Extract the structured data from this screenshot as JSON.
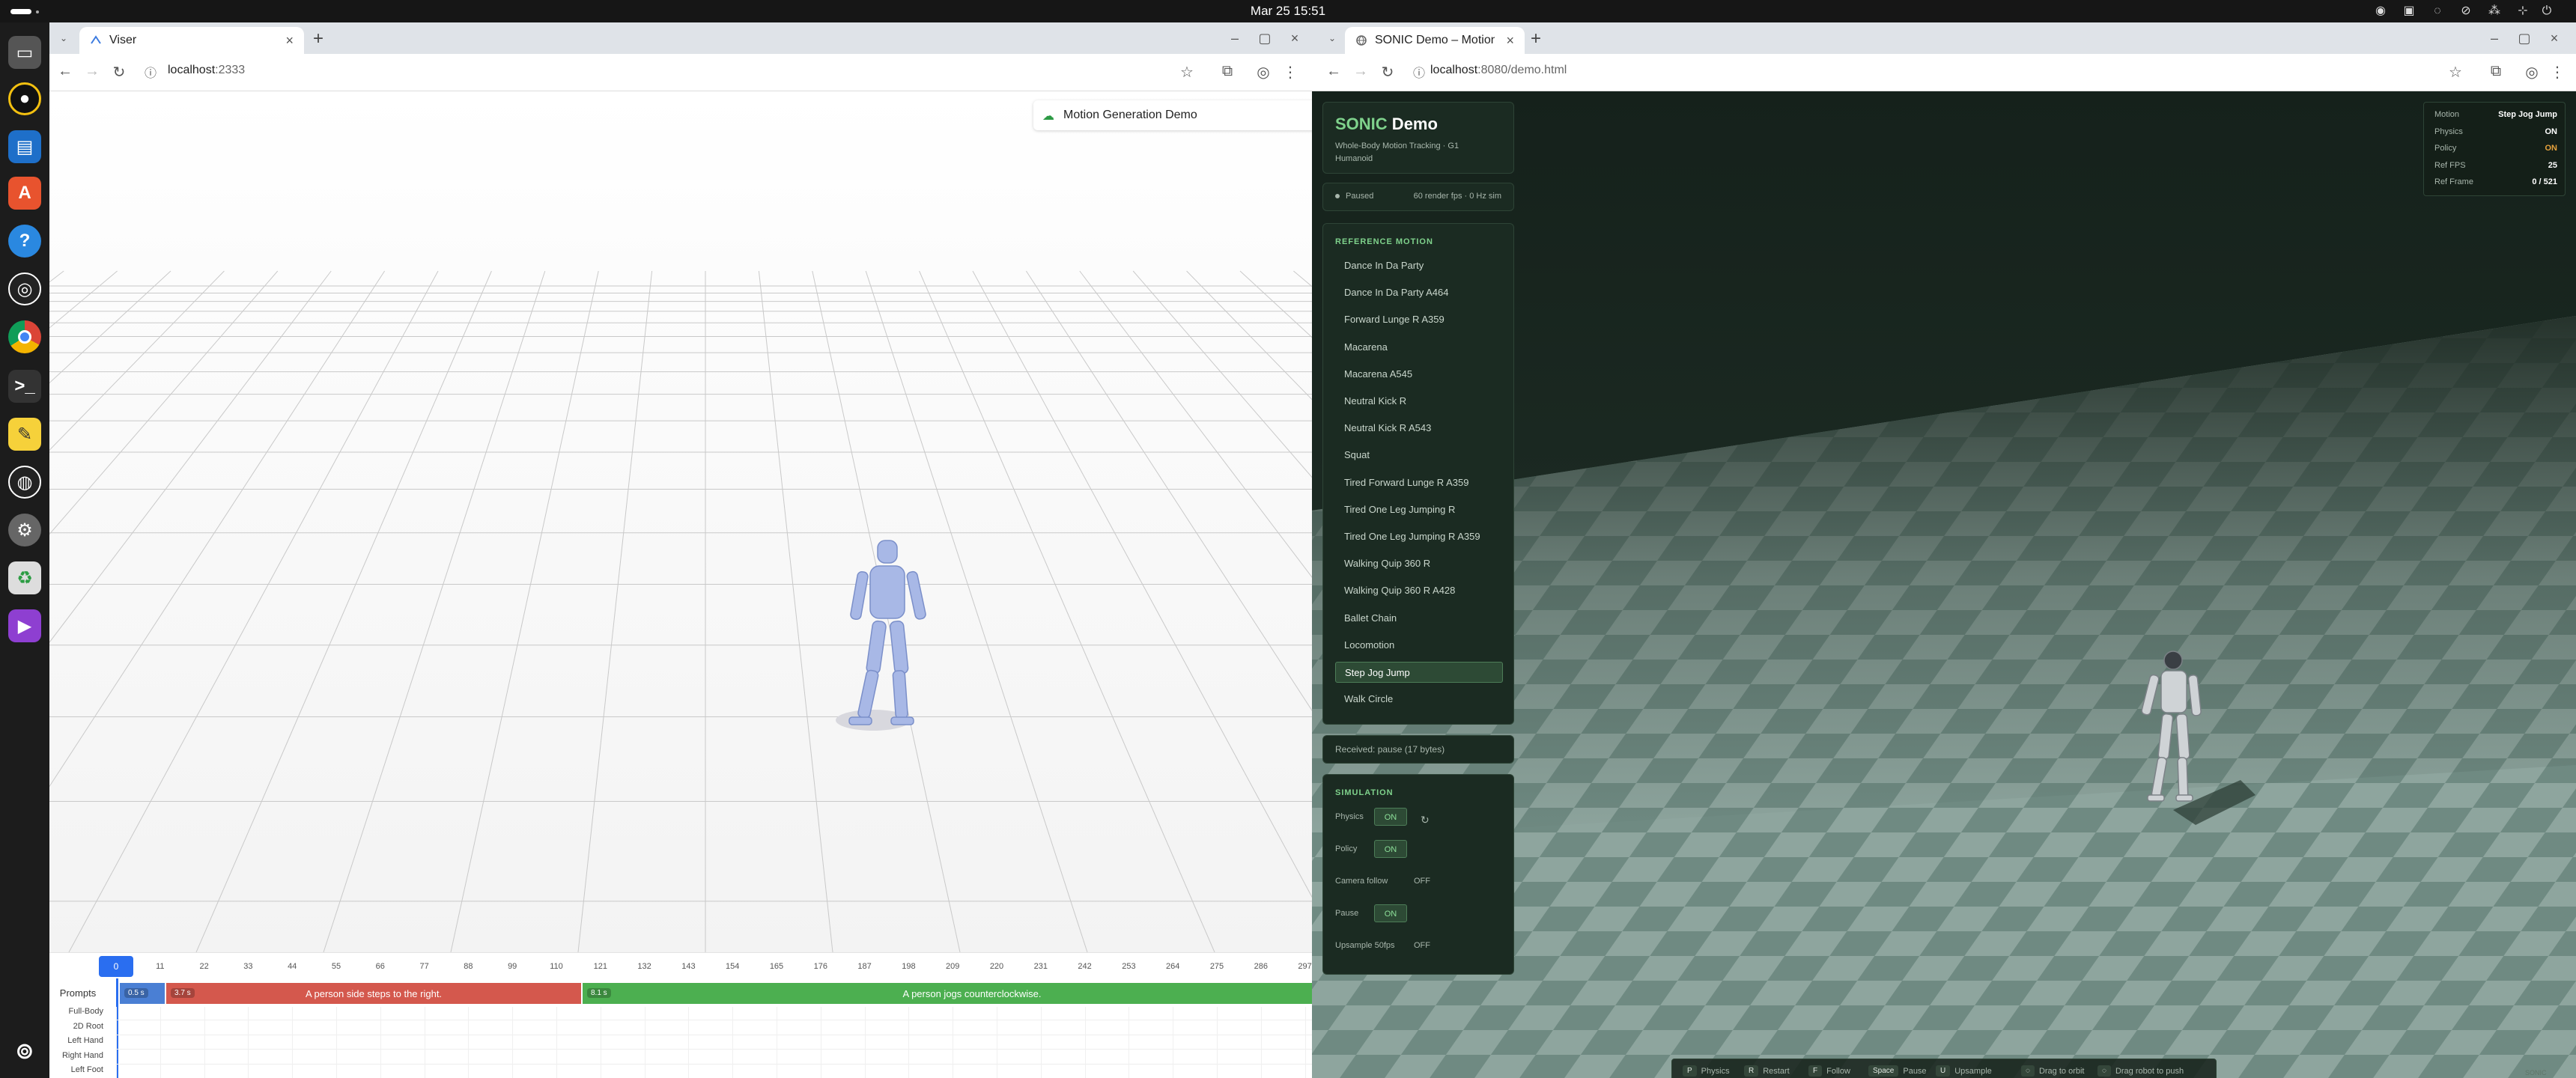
{
  "topbar": {
    "clock": "Mar 25  15:51"
  },
  "left_window": {
    "tab_title": "Viser",
    "url_host": "localhost",
    "url_path": ":2333",
    "panel_title": "Motion Generation Demo",
    "timeline": {
      "ticks": [
        "0",
        "11",
        "22",
        "33",
        "44",
        "55",
        "66",
        "77",
        "88",
        "99",
        "110",
        "121",
        "132",
        "143",
        "154",
        "165",
        "176",
        "187",
        "198",
        "209",
        "220",
        "231",
        "242",
        "253",
        "264",
        "275",
        "286",
        "297"
      ],
      "prompts_label": "Prompts",
      "track_labels": [
        "Full-Body",
        "2D Root",
        "Left Hand",
        "Right Hand",
        "Left Foot",
        "Right Foot"
      ],
      "segments": [
        {
          "badge": "0.5 s",
          "text": "",
          "color": "#4a7fd4"
        },
        {
          "badge": "3.7 s",
          "text": "A person side steps to the right.",
          "color": "#d4584d"
        },
        {
          "badge": "8.1 s",
          "text": "A person jogs counterclockwise.",
          "color": "#4caf50"
        }
      ]
    }
  },
  "right_window": {
    "tab_title": "SONIC Demo – Motion T",
    "url_host": "localhost",
    "url_path": ":8080/demo.html",
    "header": {
      "title_green": "SONIC",
      "title_white": " Demo",
      "subtitle": "Whole-Body Motion Tracking · G1 Humanoid"
    },
    "status": {
      "state": "Paused",
      "fps": "60 render fps · 0 Hz sim"
    },
    "reference_motion": {
      "label": "REFERENCE MOTION",
      "items": [
        "Dance In Da Party",
        "Dance In Da Party A464",
        "Forward Lunge R A359",
        "Macarena",
        "Macarena A545",
        "Neutral Kick R",
        "Neutral Kick R A543",
        "Squat",
        "Tired Forward Lunge R A359",
        "Tired One Leg Jumping R",
        "Tired One Leg Jumping R A359",
        "Walking Quip 360 R",
        "Walking Quip 360 R A428",
        "Ballet Chain",
        "Locomotion",
        "Step Jog Jump",
        "Walk Circle"
      ],
      "selected_index": 15
    },
    "received": "Received: pause (17 bytes)",
    "simulation": {
      "label": "SIMULATION",
      "rows": [
        {
          "label": "Physics",
          "value": "ON",
          "on": true
        },
        {
          "label": "Policy",
          "value": "ON",
          "on": true
        },
        {
          "label": "Camera follow",
          "value": "OFF",
          "on": false
        },
        {
          "label": "Pause",
          "value": "ON",
          "on": true
        },
        {
          "label": "Upsample 50fps",
          "value": "OFF",
          "on": false
        }
      ]
    },
    "stats": [
      {
        "label": "Motion",
        "value": "Step Jog Jump",
        "color": "#ffffff"
      },
      {
        "label": "Physics",
        "value": "ON",
        "color": "#ffffff"
      },
      {
        "label": "Policy",
        "value": "ON",
        "color": "#e6a23c"
      },
      {
        "label": "Ref FPS",
        "value": "25",
        "color": "#ffffff"
      },
      {
        "label": "Ref Frame",
        "value": "0 / 521",
        "color": "#ffffff"
      }
    ],
    "hotkeys": [
      {
        "key": "P",
        "label": "Physics"
      },
      {
        "key": "R",
        "label": "Restart"
      },
      {
        "key": "F",
        "label": "Follow"
      },
      {
        "key": "Space",
        "label": "Pause"
      },
      {
        "key": "U",
        "label": "Upsample"
      },
      {
        "key": "◌",
        "label": "Drag to orbit"
      },
      {
        "key": "◌",
        "label": "Drag robot to push"
      }
    ],
    "corner_text": "SONIC"
  }
}
